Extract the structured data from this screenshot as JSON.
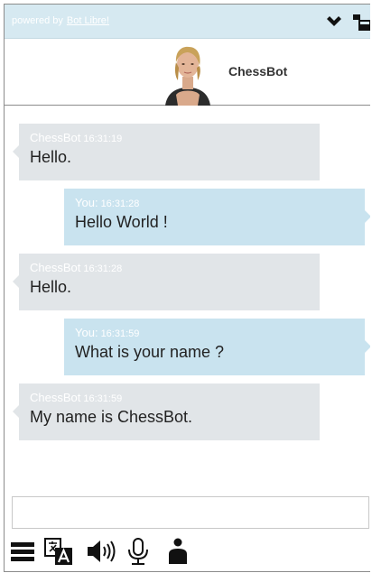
{
  "topbar": {
    "powered_prefix": "powered by",
    "powered_link": "Bot Libre!",
    "icons": [
      "chevron-down-icon",
      "window-icon"
    ]
  },
  "header": {
    "bot_name": "ChessBot",
    "avatar_icon": "avatar"
  },
  "messages": [
    {
      "role": "bot",
      "sender": "ChessBot",
      "time": "16:31:19",
      "text": "Hello."
    },
    {
      "role": "user",
      "sender": "You:",
      "time": "16:31:28",
      "text": "Hello World !"
    },
    {
      "role": "bot",
      "sender": "ChessBot",
      "time": "16:31:28",
      "text": "Hello."
    },
    {
      "role": "user",
      "sender": "You:",
      "time": "16:31:59",
      "text": "What is your name ?"
    },
    {
      "role": "bot",
      "sender": "ChessBot",
      "time": "16:31:59",
      "text": "My name is ChessBot."
    }
  ],
  "input": {
    "value": "",
    "placeholder": ""
  },
  "toolbar": {
    "icons": [
      "menu-icon",
      "translate-icon",
      "speaker-icon",
      "microphone-icon",
      "avatar-toggle-icon"
    ]
  },
  "colors": {
    "topbar_bg": "#d6e9f1",
    "bot_bubble": "#e1e5e8",
    "user_bubble": "#c9e3ef",
    "meta_text": "#ffffff",
    "message_text": "#222222"
  }
}
